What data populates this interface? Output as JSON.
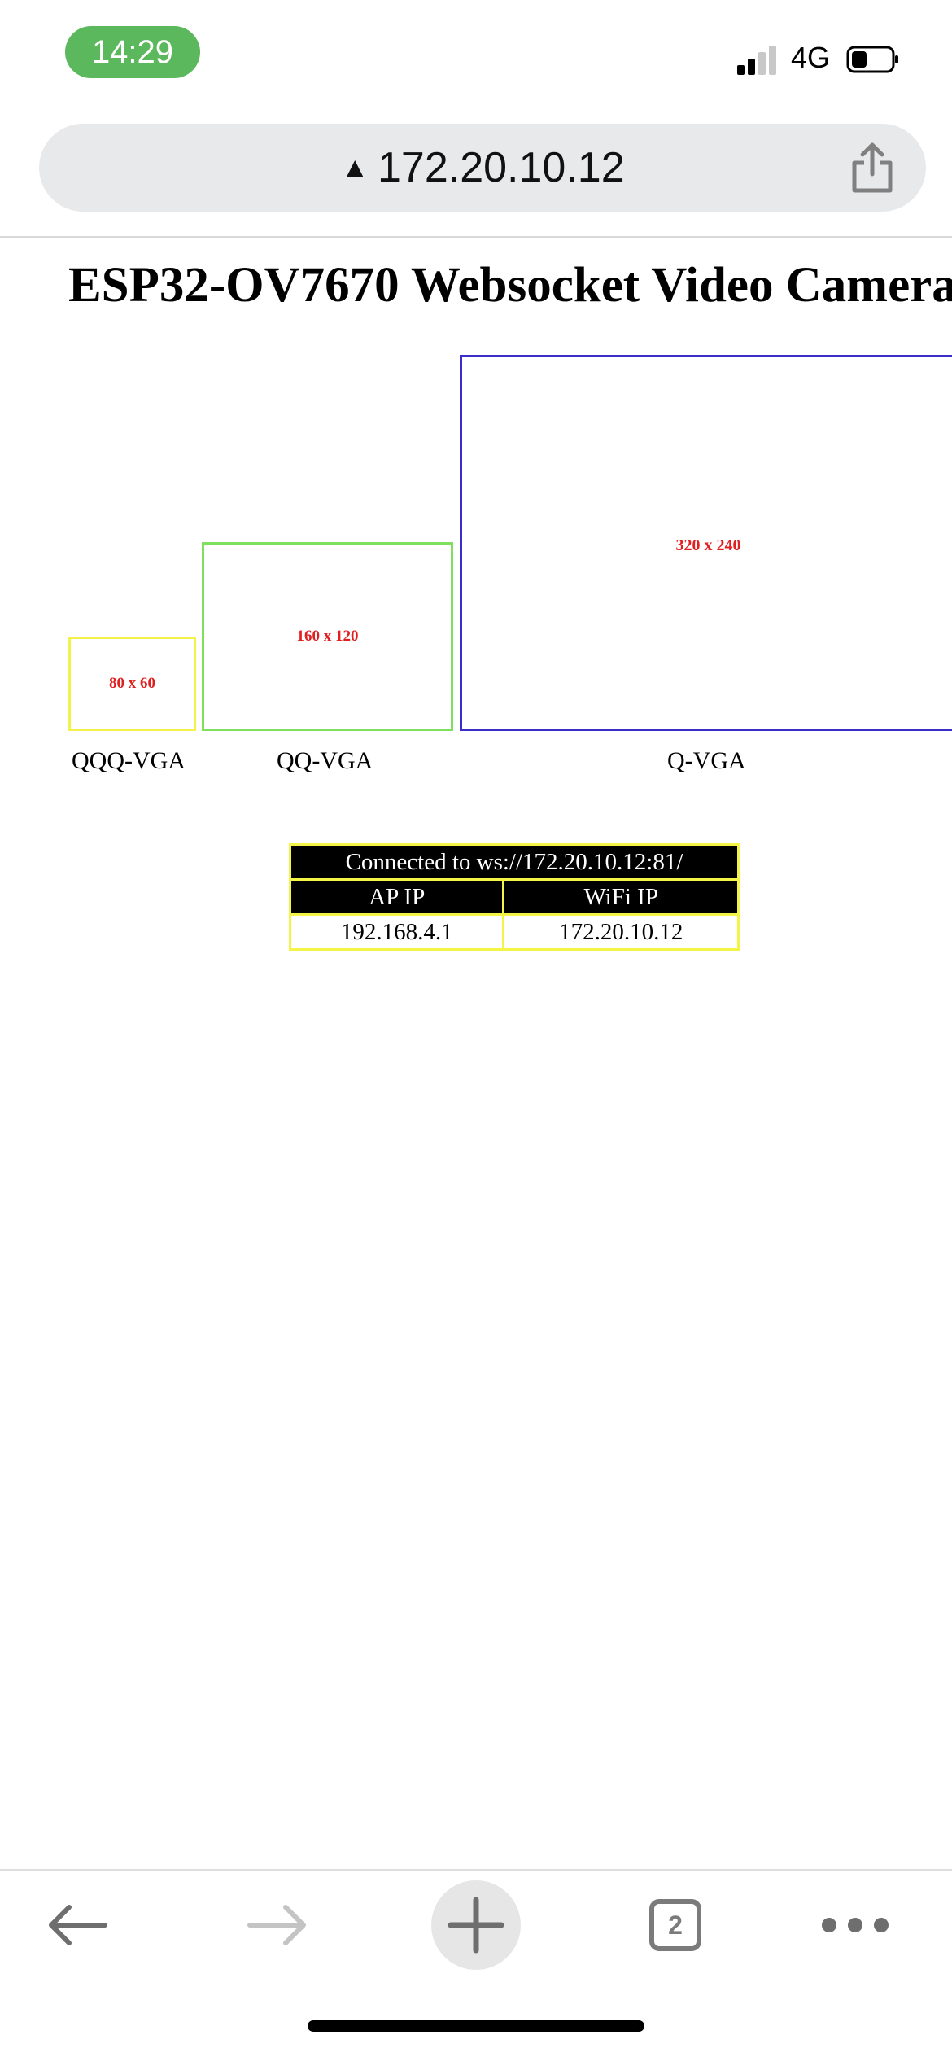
{
  "status_bar": {
    "time": "14:29",
    "network": "4G"
  },
  "address_bar": {
    "url": "172.20.10.12"
  },
  "page": {
    "title": "ESP32-OV7670 Websocket Video Camera",
    "frames": [
      {
        "size_label": "80 x 60",
        "caption": "QQQ-VGA"
      },
      {
        "size_label": "160 x 120",
        "caption": "QQ-VGA"
      },
      {
        "size_label": "320 x 240",
        "caption": "Q-VGA"
      }
    ],
    "connection": {
      "status": "Connected to ws://172.20.10.12:81/",
      "headers": [
        "AP IP",
        "WiFi IP"
      ],
      "values": [
        "192.168.4.1",
        "172.20.10.12"
      ]
    }
  },
  "toolbar": {
    "tab_count": "2"
  },
  "colors": {
    "time_pill": "#5cb85c",
    "frame_qqq": "#f2f24a",
    "frame_qq": "#7fe060",
    "frame_q": "#3a2ec8",
    "frame_label": "#e02020",
    "table_border": "#f4f447"
  }
}
